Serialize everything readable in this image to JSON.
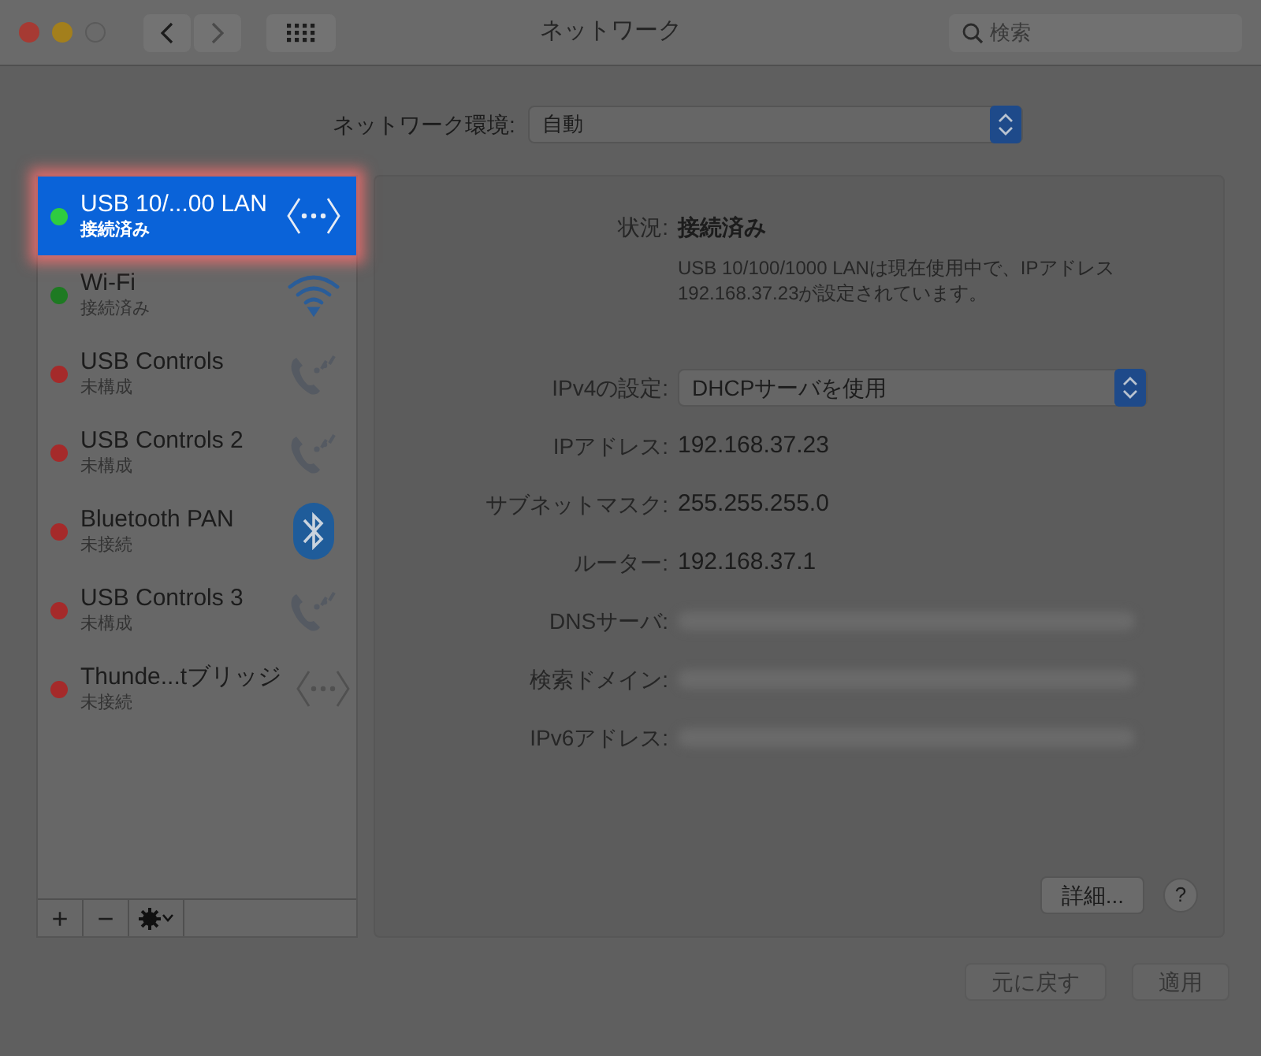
{
  "window": {
    "title": "ネットワーク"
  },
  "search": {
    "placeholder": "検索"
  },
  "location": {
    "label": "ネットワーク環境:",
    "value": "自動"
  },
  "services": [
    {
      "name": "USB 10/...00 LAN",
      "status": "接続済み",
      "color": "#2ecc40",
      "kind": "ethernet",
      "selected": true
    },
    {
      "name": "Wi-Fi",
      "status": "接続済み",
      "color": "#1e7a22",
      "kind": "wifi",
      "selected": false
    },
    {
      "name": "USB Controls",
      "status": "未構成",
      "color": "#a52a2a",
      "kind": "phone",
      "selected": false
    },
    {
      "name": "USB Controls 2",
      "status": "未構成",
      "color": "#a52a2a",
      "kind": "phone",
      "selected": false
    },
    {
      "name": "Bluetooth PAN",
      "status": "未接続",
      "color": "#a52a2a",
      "kind": "bluetooth",
      "selected": false
    },
    {
      "name": "USB Controls 3",
      "status": "未構成",
      "color": "#a52a2a",
      "kind": "phone",
      "selected": false
    },
    {
      "name": "Thunde...tブリッジ",
      "status": "未接続",
      "color": "#a52a2a",
      "kind": "ethernet",
      "selected": false
    }
  ],
  "list_buttons": [
    "+",
    "−"
  ],
  "detail": {
    "status_label": "状況:",
    "status_value": "接続済み",
    "description": "USB 10/100/1000 LANは現在使用中で、IPアドレス 192.168.37.23が設定されています。",
    "fields": [
      {
        "label": "IPv4の設定:",
        "kind": "select",
        "value": "DHCPサーバを使用"
      },
      {
        "label": "IPアドレス:",
        "kind": "text",
        "value": "192.168.37.23"
      },
      {
        "label": "サブネットマスク:",
        "kind": "text",
        "value": "255.255.255.0"
      },
      {
        "label": "ルーター:",
        "kind": "text",
        "value": "192.168.37.1"
      },
      {
        "label": "DNSサーバ:",
        "kind": "hidden"
      },
      {
        "label": "検索ドメイン:",
        "kind": "hidden"
      },
      {
        "label": "IPv6アドレス:",
        "kind": "hidden"
      }
    ],
    "advanced_button": "詳細...",
    "help_button": "?"
  },
  "footer_buttons": [
    {
      "label": "元に戻す",
      "disabled": true
    },
    {
      "label": "適用",
      "disabled": true
    }
  ]
}
